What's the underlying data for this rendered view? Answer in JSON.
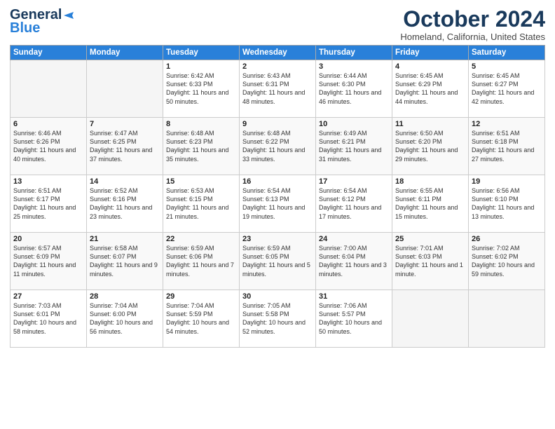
{
  "header": {
    "logo_general": "General",
    "logo_blue": "Blue",
    "title": "October 2024",
    "location": "Homeland, California, United States"
  },
  "days_of_week": [
    "Sunday",
    "Monday",
    "Tuesday",
    "Wednesday",
    "Thursday",
    "Friday",
    "Saturday"
  ],
  "weeks": [
    [
      {
        "day": "",
        "content": ""
      },
      {
        "day": "",
        "content": ""
      },
      {
        "day": "1",
        "content": "Sunrise: 6:42 AM\nSunset: 6:33 PM\nDaylight: 11 hours and 50 minutes."
      },
      {
        "day": "2",
        "content": "Sunrise: 6:43 AM\nSunset: 6:31 PM\nDaylight: 11 hours and 48 minutes."
      },
      {
        "day": "3",
        "content": "Sunrise: 6:44 AM\nSunset: 6:30 PM\nDaylight: 11 hours and 46 minutes."
      },
      {
        "day": "4",
        "content": "Sunrise: 6:45 AM\nSunset: 6:29 PM\nDaylight: 11 hours and 44 minutes."
      },
      {
        "day": "5",
        "content": "Sunrise: 6:45 AM\nSunset: 6:27 PM\nDaylight: 11 hours and 42 minutes."
      }
    ],
    [
      {
        "day": "6",
        "content": "Sunrise: 6:46 AM\nSunset: 6:26 PM\nDaylight: 11 hours and 40 minutes."
      },
      {
        "day": "7",
        "content": "Sunrise: 6:47 AM\nSunset: 6:25 PM\nDaylight: 11 hours and 37 minutes."
      },
      {
        "day": "8",
        "content": "Sunrise: 6:48 AM\nSunset: 6:23 PM\nDaylight: 11 hours and 35 minutes."
      },
      {
        "day": "9",
        "content": "Sunrise: 6:48 AM\nSunset: 6:22 PM\nDaylight: 11 hours and 33 minutes."
      },
      {
        "day": "10",
        "content": "Sunrise: 6:49 AM\nSunset: 6:21 PM\nDaylight: 11 hours and 31 minutes."
      },
      {
        "day": "11",
        "content": "Sunrise: 6:50 AM\nSunset: 6:20 PM\nDaylight: 11 hours and 29 minutes."
      },
      {
        "day": "12",
        "content": "Sunrise: 6:51 AM\nSunset: 6:18 PM\nDaylight: 11 hours and 27 minutes."
      }
    ],
    [
      {
        "day": "13",
        "content": "Sunrise: 6:51 AM\nSunset: 6:17 PM\nDaylight: 11 hours and 25 minutes."
      },
      {
        "day": "14",
        "content": "Sunrise: 6:52 AM\nSunset: 6:16 PM\nDaylight: 11 hours and 23 minutes."
      },
      {
        "day": "15",
        "content": "Sunrise: 6:53 AM\nSunset: 6:15 PM\nDaylight: 11 hours and 21 minutes."
      },
      {
        "day": "16",
        "content": "Sunrise: 6:54 AM\nSunset: 6:13 PM\nDaylight: 11 hours and 19 minutes."
      },
      {
        "day": "17",
        "content": "Sunrise: 6:54 AM\nSunset: 6:12 PM\nDaylight: 11 hours and 17 minutes."
      },
      {
        "day": "18",
        "content": "Sunrise: 6:55 AM\nSunset: 6:11 PM\nDaylight: 11 hours and 15 minutes."
      },
      {
        "day": "19",
        "content": "Sunrise: 6:56 AM\nSunset: 6:10 PM\nDaylight: 11 hours and 13 minutes."
      }
    ],
    [
      {
        "day": "20",
        "content": "Sunrise: 6:57 AM\nSunset: 6:09 PM\nDaylight: 11 hours and 11 minutes."
      },
      {
        "day": "21",
        "content": "Sunrise: 6:58 AM\nSunset: 6:07 PM\nDaylight: 11 hours and 9 minutes."
      },
      {
        "day": "22",
        "content": "Sunrise: 6:59 AM\nSunset: 6:06 PM\nDaylight: 11 hours and 7 minutes."
      },
      {
        "day": "23",
        "content": "Sunrise: 6:59 AM\nSunset: 6:05 PM\nDaylight: 11 hours and 5 minutes."
      },
      {
        "day": "24",
        "content": "Sunrise: 7:00 AM\nSunset: 6:04 PM\nDaylight: 11 hours and 3 minutes."
      },
      {
        "day": "25",
        "content": "Sunrise: 7:01 AM\nSunset: 6:03 PM\nDaylight: 11 hours and 1 minute."
      },
      {
        "day": "26",
        "content": "Sunrise: 7:02 AM\nSunset: 6:02 PM\nDaylight: 10 hours and 59 minutes."
      }
    ],
    [
      {
        "day": "27",
        "content": "Sunrise: 7:03 AM\nSunset: 6:01 PM\nDaylight: 10 hours and 58 minutes."
      },
      {
        "day": "28",
        "content": "Sunrise: 7:04 AM\nSunset: 6:00 PM\nDaylight: 10 hours and 56 minutes."
      },
      {
        "day": "29",
        "content": "Sunrise: 7:04 AM\nSunset: 5:59 PM\nDaylight: 10 hours and 54 minutes."
      },
      {
        "day": "30",
        "content": "Sunrise: 7:05 AM\nSunset: 5:58 PM\nDaylight: 10 hours and 52 minutes."
      },
      {
        "day": "31",
        "content": "Sunrise: 7:06 AM\nSunset: 5:57 PM\nDaylight: 10 hours and 50 minutes."
      },
      {
        "day": "",
        "content": ""
      },
      {
        "day": "",
        "content": ""
      }
    ]
  ]
}
